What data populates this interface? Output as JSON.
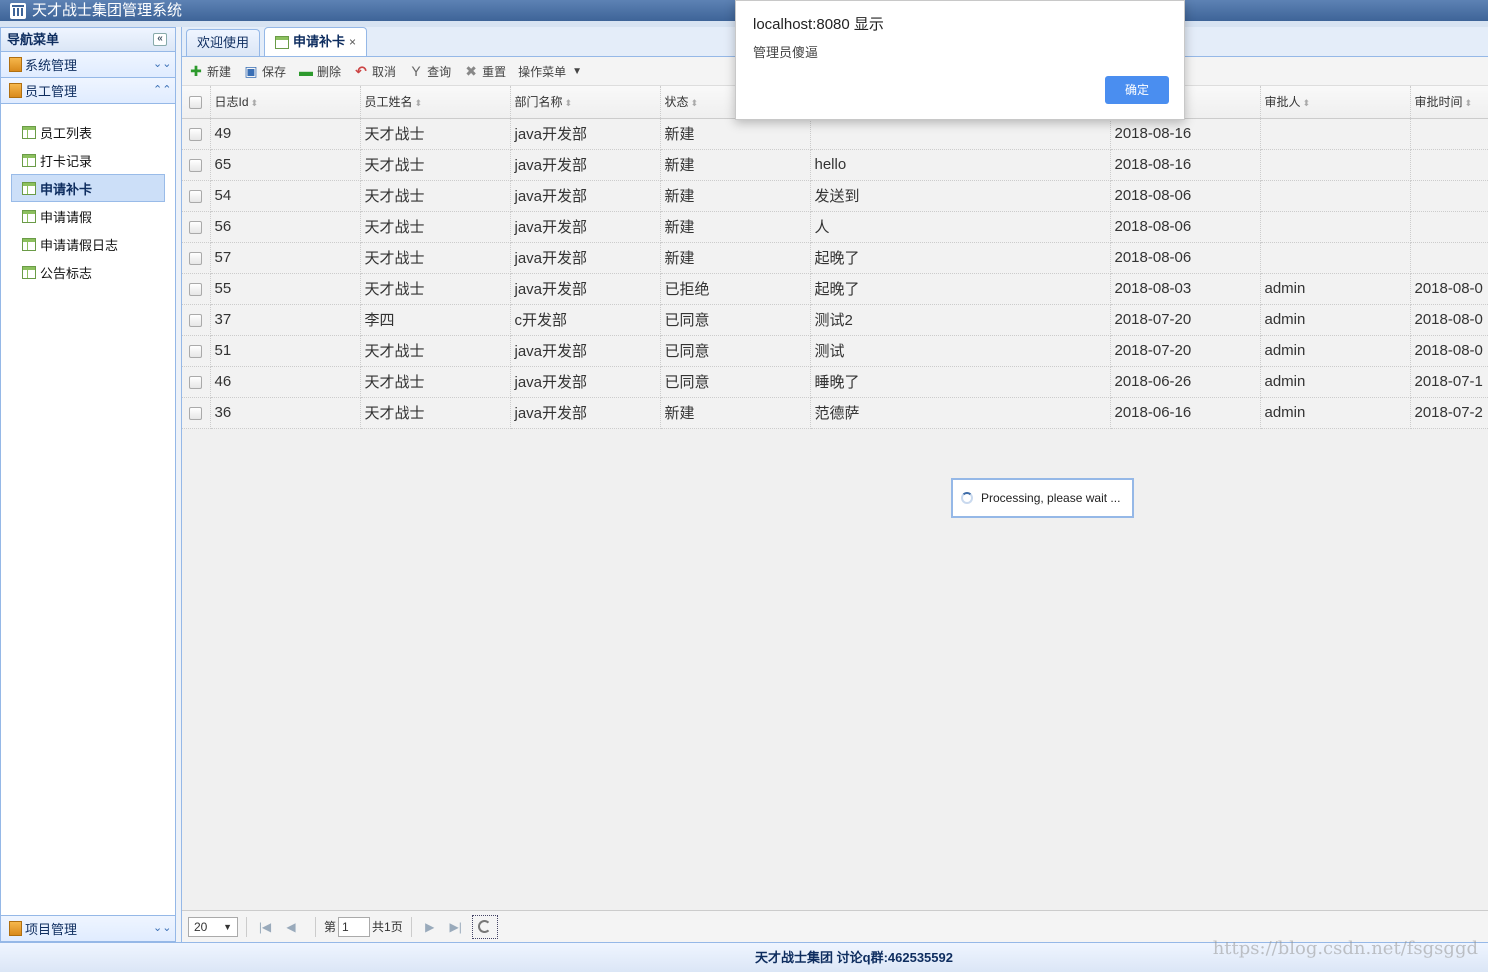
{
  "app": {
    "title": "天才战士集团管理系统"
  },
  "nav": {
    "header": "导航菜单",
    "collapse_glyph": "«",
    "sections": [
      {
        "label": "系统管理",
        "state": "collapsed"
      },
      {
        "label": "员工管理",
        "state": "expanded"
      }
    ],
    "items": [
      {
        "label": "员工列表"
      },
      {
        "label": "打卡记录"
      },
      {
        "label": "申请补卡",
        "active": true
      },
      {
        "label": "申请请假"
      },
      {
        "label": "申请请假日志"
      },
      {
        "label": "公告标志"
      }
    ],
    "bottom_section": {
      "label": "项目管理",
      "state": "collapsed"
    }
  },
  "tabs": [
    {
      "label": "欢迎使用"
    },
    {
      "label": "申请补卡",
      "active": true,
      "close": "×"
    }
  ],
  "toolbar": {
    "new": "新建",
    "save": "保存",
    "delete": "删除",
    "cancel": "取消",
    "query": "查询",
    "reset": "重置",
    "ops": "操作菜单"
  },
  "grid": {
    "headers": [
      "日志Id",
      "员工姓名",
      "部门名称",
      "状态",
      "",
      "",
      "审批人",
      "审批时间"
    ],
    "rows": [
      [
        "49",
        "天才战士",
        "java开发部",
        "新建",
        "",
        "2018-08-16",
        "",
        ""
      ],
      [
        "65",
        "天才战士",
        "java开发部",
        "新建",
        "hello",
        "2018-08-16",
        "",
        ""
      ],
      [
        "54",
        "天才战士",
        "java开发部",
        "新建",
        "发送到",
        "2018-08-06",
        "",
        ""
      ],
      [
        "56",
        "天才战士",
        "java开发部",
        "新建",
        "人",
        "2018-08-06",
        "",
        ""
      ],
      [
        "57",
        "天才战士",
        "java开发部",
        "新建",
        "起晚了",
        "2018-08-06",
        "",
        ""
      ],
      [
        "55",
        "天才战士",
        "java开发部",
        "已拒绝",
        "起晚了",
        "2018-08-03",
        "admin",
        "2018-08-0"
      ],
      [
        "37",
        "李四",
        "c开发部",
        "已同意",
        "测试2",
        "2018-07-20",
        "admin",
        "2018-08-0"
      ],
      [
        "51",
        "天才战士",
        "java开发部",
        "已同意",
        "测试",
        "2018-07-20",
        "admin",
        "2018-08-0"
      ],
      [
        "46",
        "天才战士",
        "java开发部",
        "已同意",
        "睡晚了",
        "2018-06-26",
        "admin",
        "2018-07-1"
      ],
      [
        "36",
        "天才战士",
        "java开发部",
        "新建",
        "范德萨",
        "2018-06-16",
        "admin",
        "2018-07-2"
      ]
    ]
  },
  "loading": {
    "text": "Processing, please wait ..."
  },
  "pager": {
    "page_size": "20",
    "page_prefix": "第",
    "page_value": "1",
    "total": "共1页"
  },
  "footer": {
    "text": "天才战士集团 讨论q群:462535592"
  },
  "watermark": "https://blog.csdn.net/fsgsggd",
  "alert": {
    "title": "localhost:8080 显示",
    "message": "管理员傻逼",
    "ok": "确定",
    "button_color": "#4a8ef0"
  },
  "colors": {
    "accent": "#95b8e7",
    "title_bg": "#3e6498",
    "highlight_text": "#e33333"
  }
}
